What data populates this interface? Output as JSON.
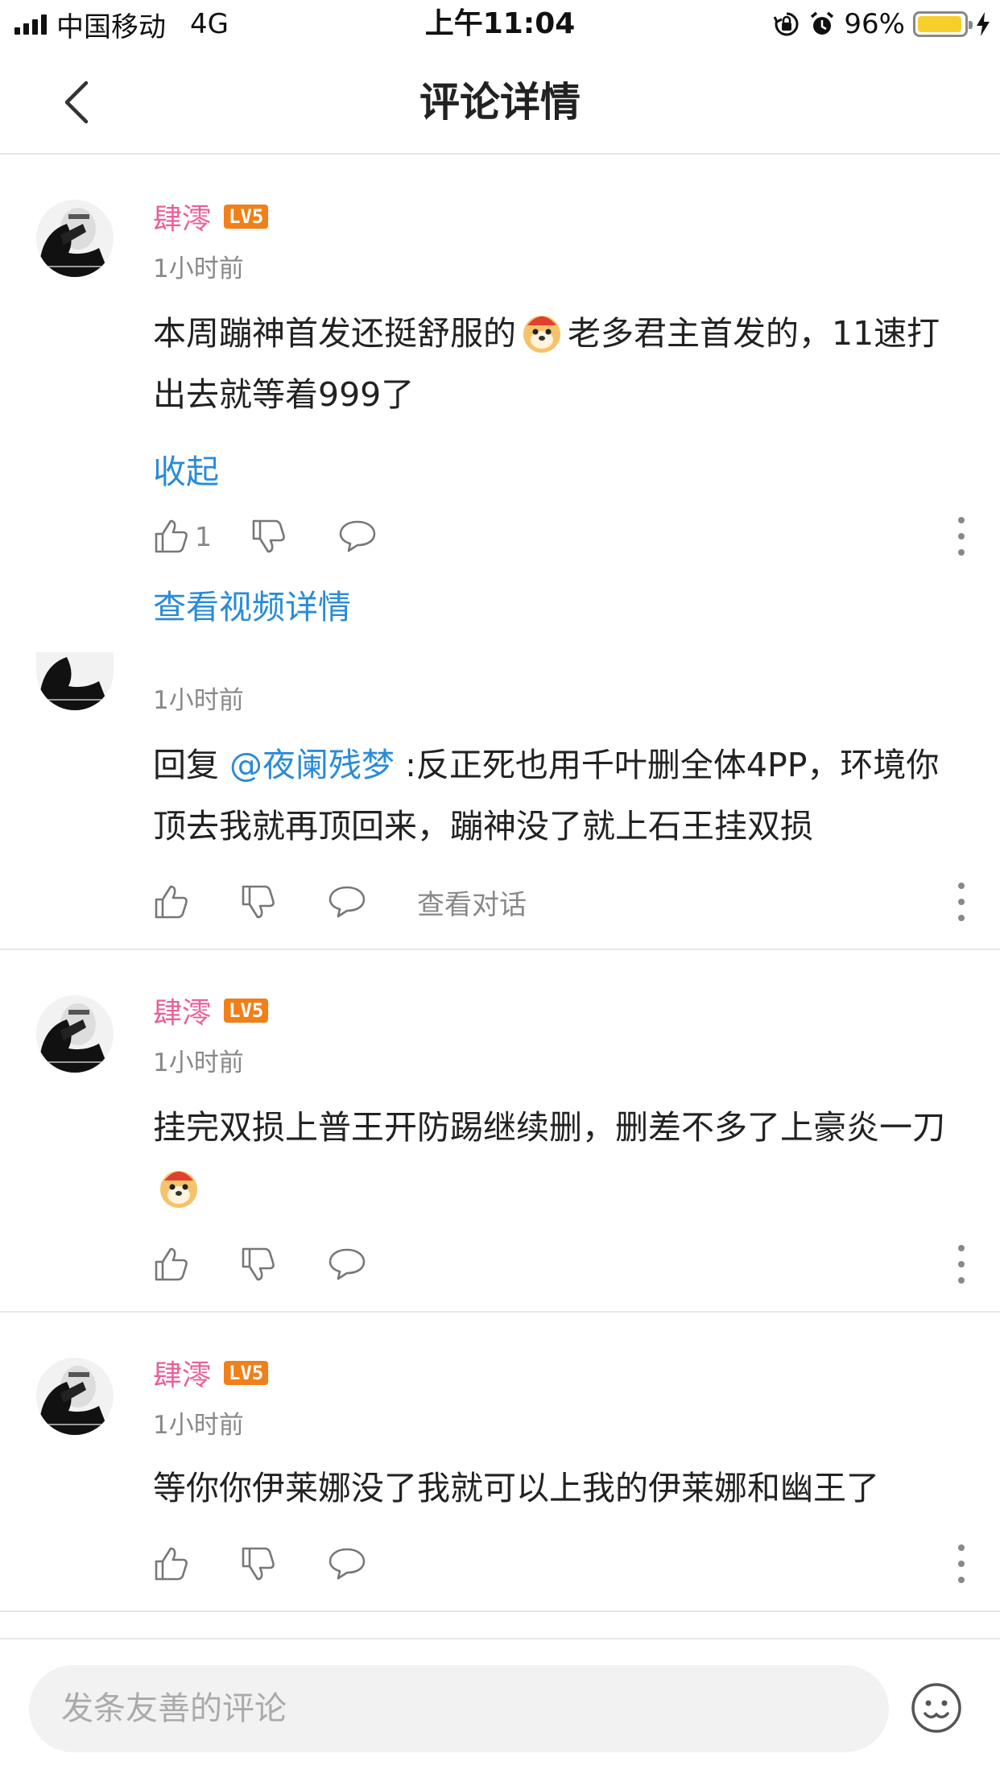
{
  "status_bar": {
    "carrier": "中国移动",
    "network": "4G",
    "time": "上午11:04",
    "battery": "96%",
    "battery_level": 0.96,
    "icons": [
      "signal-icon",
      "rotation-lock-icon",
      "alarm-icon",
      "battery-icon",
      "charging-icon"
    ]
  },
  "nav": {
    "title": "评论详情",
    "back_icon": "chevron-left-icon"
  },
  "comments": [
    {
      "username": "肆澪",
      "level": "LV5",
      "time": "1小时前",
      "text_before": "本周蹦神首发还挺舒服的",
      "text_after": "老多君主首发的，11速打出去就等着999了",
      "collapse_label": "收起",
      "like_count": "1",
      "view_video_label": "查看视频详情"
    },
    {
      "username": "",
      "time": "1小时前",
      "reply_prefix": "回复 ",
      "mention": "@夜阑残梦",
      "text": " :反正死也用千叶删全体4PP，环境你顶去我就再顶回来，蹦神没了就上石王挂双损",
      "view_dialog_label": "查看对话"
    },
    {
      "username": "肆澪",
      "level": "LV5",
      "time": "1小时前",
      "text": "挂完双损上普王开防踢继续删，删差不多了上豪炎一刀"
    },
    {
      "username": "肆澪",
      "level": "LV5",
      "time": "1小时前",
      "text": "等你你伊莱娜没了我就可以上我的伊莱娜和幽王了"
    }
  ],
  "bottom": {
    "input_placeholder": "发条友善的评论",
    "emoji_icon": "smiley-face-icon"
  },
  "colors": {
    "username": "#e8609a",
    "level_badge": "#f08019",
    "link": "#2a8bd8",
    "muted": "#888888",
    "divider": "#e6e6e6"
  }
}
